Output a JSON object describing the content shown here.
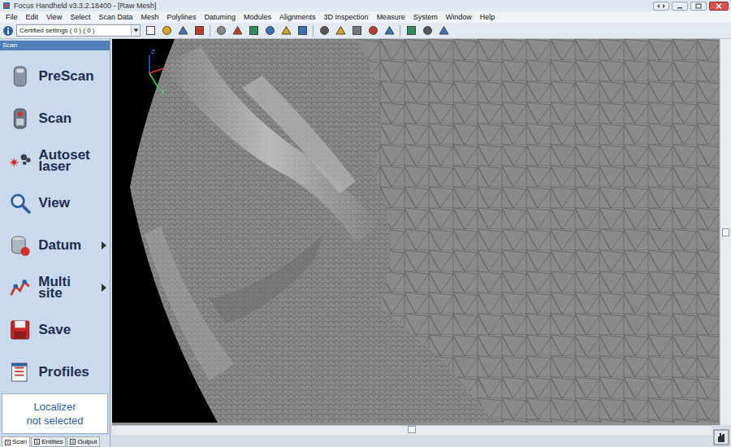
{
  "window": {
    "title": "Focus Handheld v3.3.2.18400 - [Raw Mesh]"
  },
  "menu": [
    "File",
    "Edit",
    "View",
    "Select",
    "Scan Data",
    "Mesh",
    "Polylines",
    "Datuming",
    "Modules",
    "Alignments",
    "3D Inspection",
    "Measure",
    "System",
    "Window",
    "Help"
  ],
  "toolbar": {
    "settings": "Certified settings ( 0 ) ( 0 )"
  },
  "panel": {
    "title": "Scan",
    "items": [
      {
        "label": "PreScan",
        "submenu": false
      },
      {
        "label": "Scan",
        "submenu": false
      },
      {
        "label": "Autoset laser",
        "submenu": false
      },
      {
        "label": "View",
        "submenu": false
      },
      {
        "label": "Datum",
        "submenu": true
      },
      {
        "label": "Multi site",
        "submenu": true
      },
      {
        "label": "Save",
        "submenu": false
      },
      {
        "label": "Profiles",
        "submenu": false
      }
    ],
    "status": [
      "Localizer",
      "not selected"
    ]
  },
  "bottom_tabs": [
    {
      "label": "Scan",
      "selected": true
    },
    {
      "label": "Entities",
      "selected": false
    },
    {
      "label": "Output",
      "selected": false
    }
  ],
  "viewport": {
    "axes": [
      "Z",
      "Y"
    ]
  }
}
